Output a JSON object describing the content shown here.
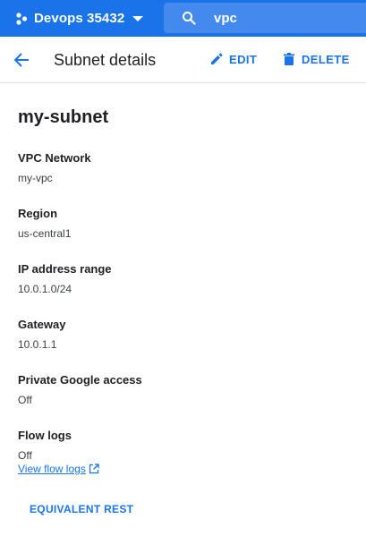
{
  "topbar": {
    "project_label": "Devops 35432",
    "project_icon": "project-hexagon-icon",
    "dropdown_icon": "caret-down-icon",
    "search_icon": "search-icon",
    "search_value": "vpc",
    "bar_color": "#1a73e8"
  },
  "subheader": {
    "back_icon": "arrow-back-icon",
    "title": "Subnet details",
    "edit_label": "EDIT",
    "edit_icon": "pencil-icon",
    "delete_label": "DELETE",
    "delete_icon": "trash-icon"
  },
  "subnet": {
    "name": "my-subnet",
    "fields": [
      {
        "label": "VPC Network",
        "value": "my-vpc"
      },
      {
        "label": "Region",
        "value": "us-central1"
      },
      {
        "label": "IP address range",
        "value": "10.0.1.0/24"
      },
      {
        "label": "Gateway",
        "value": "10.0.1.1"
      },
      {
        "label": "Private Google access",
        "value": "Off"
      },
      {
        "label": "Flow logs",
        "value": "Off"
      }
    ],
    "flow_logs_link": "View flow logs",
    "link_icon": "open-in-new-icon"
  },
  "footer": {
    "equivalent_rest": "EQUIVALENT REST"
  }
}
